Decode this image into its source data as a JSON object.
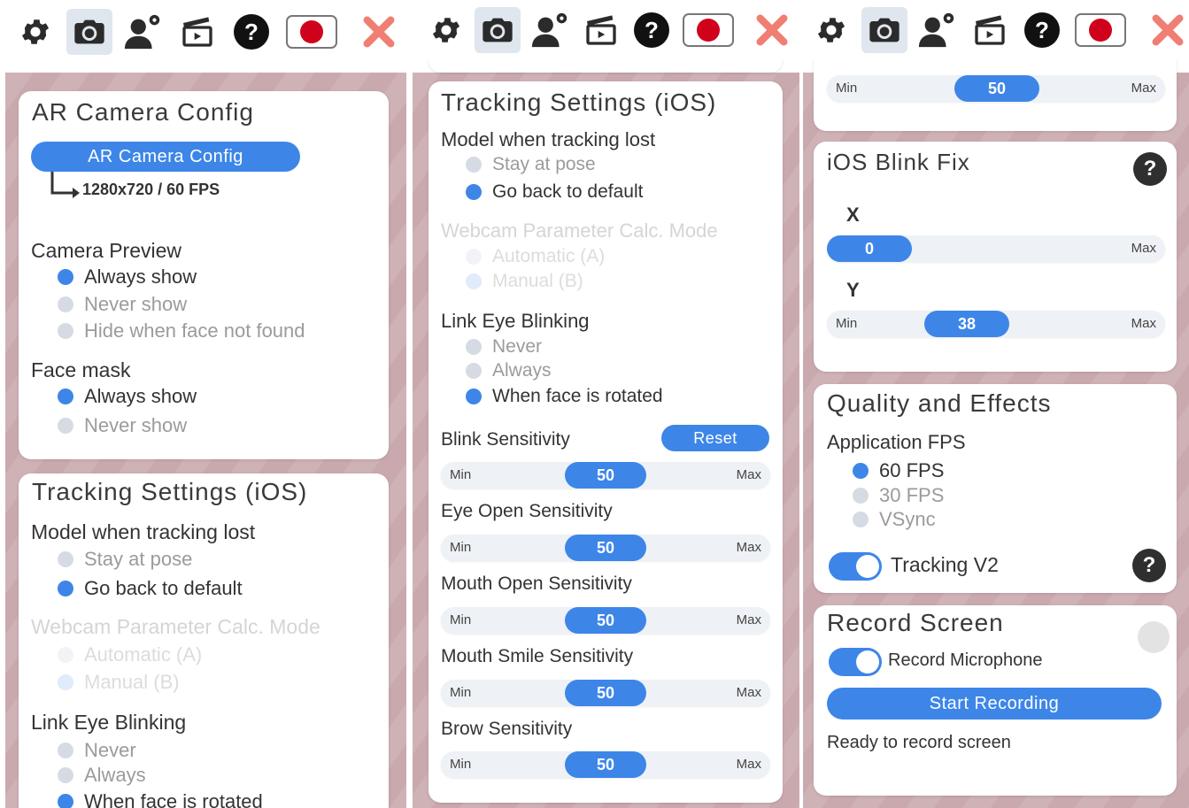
{
  "toolbar": {
    "icons": [
      "settings-gear-icon",
      "camera-icon",
      "user-settings-icon",
      "clapperboard-icon",
      "help-icon",
      "record-icon",
      "close-icon"
    ],
    "active": "camera-icon",
    "record_color": "#d0021b",
    "close_color": "#f07e72"
  },
  "ar_camera": {
    "title": "AR Camera Config",
    "button": "AR Camera Config",
    "resolution": "1280x720 / 60 FPS"
  },
  "camera_preview": {
    "label": "Camera Preview",
    "options": [
      "Always show",
      "Never show",
      "Hide when face not found"
    ],
    "selected": "Always show"
  },
  "face_mask": {
    "label": "Face mask",
    "options": [
      "Always show",
      "Never show"
    ],
    "selected": "Always show"
  },
  "tracking": {
    "title": "Tracking Settings (iOS)",
    "model_lost_label": "Model when tracking lost",
    "model_lost_options": [
      "Stay at pose",
      "Go back to default"
    ],
    "model_lost_selected": "Go back to default",
    "webcam_label": "Webcam Parameter Calc. Mode",
    "webcam_options": [
      "Automatic (A)",
      "Manual (B)"
    ],
    "webcam_selected": "Manual (B)",
    "link_blink_label": "Link Eye Blinking",
    "link_blink_options": [
      "Never",
      "Always",
      "When face is rotated"
    ],
    "link_blink_selected": "When face is rotated",
    "reset_label": "Reset"
  },
  "sensitivities": [
    {
      "label": "Blink Sensitivity",
      "value": "50"
    },
    {
      "label": "Eye Open Sensitivity",
      "value": "50"
    },
    {
      "label": "Mouth Open Sensitivity",
      "value": "50"
    },
    {
      "label": "Mouth Smile Sensitivity",
      "value": "50"
    },
    {
      "label": "Brow Sensitivity",
      "value": "50"
    }
  ],
  "slider_text": {
    "min": "Min",
    "max": "Max"
  },
  "ios_blink_fix": {
    "title": "iOS Blink Fix",
    "x_label": "X",
    "x_value": "0",
    "y_label": "Y",
    "y_value": "38"
  },
  "quality": {
    "title": "Quality and Effects",
    "fps_label": "Application FPS",
    "fps_options": [
      "60 FPS",
      "30 FPS",
      "VSync"
    ],
    "fps_selected": "60 FPS",
    "tracking_v2_label": "Tracking V2",
    "tracking_v2_on": true
  },
  "record": {
    "title": "Record Screen",
    "mic_label": "Record Microphone",
    "mic_on": true,
    "start_label": "Start Recording",
    "status": "Ready to record screen"
  }
}
